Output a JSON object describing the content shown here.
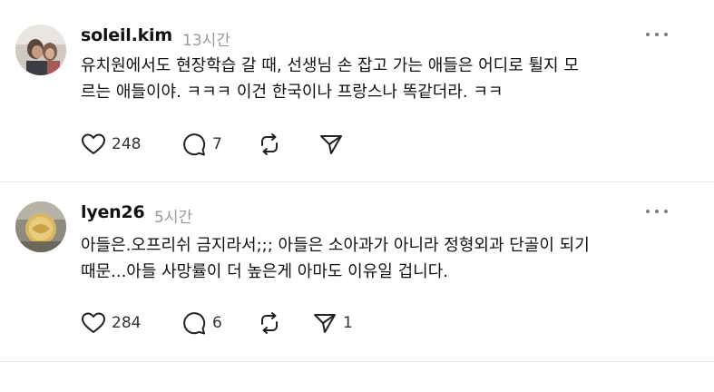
{
  "posts": [
    {
      "username": "soleil.kim",
      "time": "13시간",
      "text_line1": "유치원에서도 현장학습 갈 때, 선생님 손 잡고 가는 애들은 어디로 튈지 모",
      "text_line2": "르는 애들이야. ㅋㅋㅋ 이건 한국이나 프랑스나 똑같더라. ㅋㅋ",
      "likes": "248",
      "comments": "7",
      "reposts": "",
      "shares": ""
    },
    {
      "username": "lyen26",
      "time": "5시간",
      "text_line1": "아들은.오프리쉬 금지라서;;; 아들은 소아과가 아니라 정형외과 단골이 되기",
      "text_line2": "때문...아들 사망률이 더 높은게 아마도 이유일 겁니다.",
      "likes": "284",
      "comments": "6",
      "reposts": "",
      "shares": "1"
    }
  ],
  "colors": {
    "icon": "#222222",
    "muted": "#9a9a9a",
    "divider": "#e6e6e6"
  },
  "icons": [
    "heart-icon",
    "comment-icon",
    "repost-icon",
    "share-icon",
    "more-icon"
  ]
}
